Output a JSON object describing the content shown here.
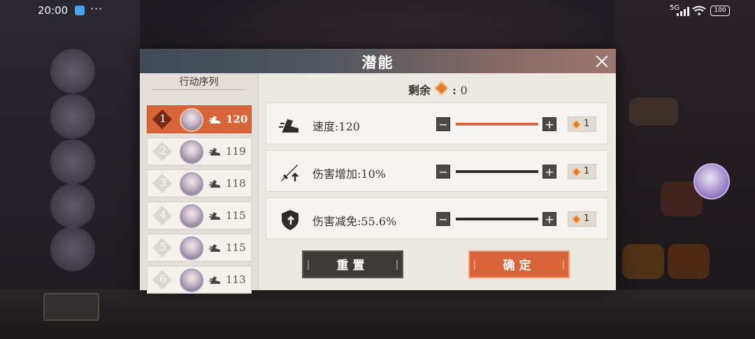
{
  "status_bar": {
    "time": "20:00",
    "dots": "···",
    "network": "5G",
    "battery": "100"
  },
  "modal": {
    "title": "潜能",
    "sequence": {
      "title": "行动序列",
      "items": [
        {
          "rank": "1",
          "speed": "120",
          "active": true
        },
        {
          "rank": "2",
          "speed": "119",
          "active": false
        },
        {
          "rank": "3",
          "speed": "118",
          "active": false
        },
        {
          "rank": "4",
          "speed": "115",
          "active": false
        },
        {
          "rank": "5",
          "speed": "115",
          "active": false
        },
        {
          "rank": "6",
          "speed": "113",
          "active": false
        }
      ]
    },
    "remaining": {
      "label": "剩余",
      "separator": ":",
      "value": "0"
    },
    "stats": [
      {
        "name": "速度",
        "value": "120",
        "label": "速度:120",
        "level": 1.0,
        "cost": "1",
        "icon": "speed-boot-icon"
      },
      {
        "name": "伤害增加",
        "value": "10%",
        "label": "伤害增加:10%",
        "level": 0.0,
        "cost": "1",
        "icon": "sword-up-icon"
      },
      {
        "name": "伤害减免",
        "value": "55.6%",
        "label": "伤害减免:55.6%",
        "level": 0.0,
        "cost": "1",
        "icon": "shield-up-icon"
      }
    ],
    "buttons": {
      "reset": "重置",
      "confirm": "确定",
      "minus": "−",
      "plus": "+"
    },
    "colors": {
      "accent": "#d8643a",
      "header": "#4a525c",
      "dark_button": "#3e3a38"
    }
  }
}
